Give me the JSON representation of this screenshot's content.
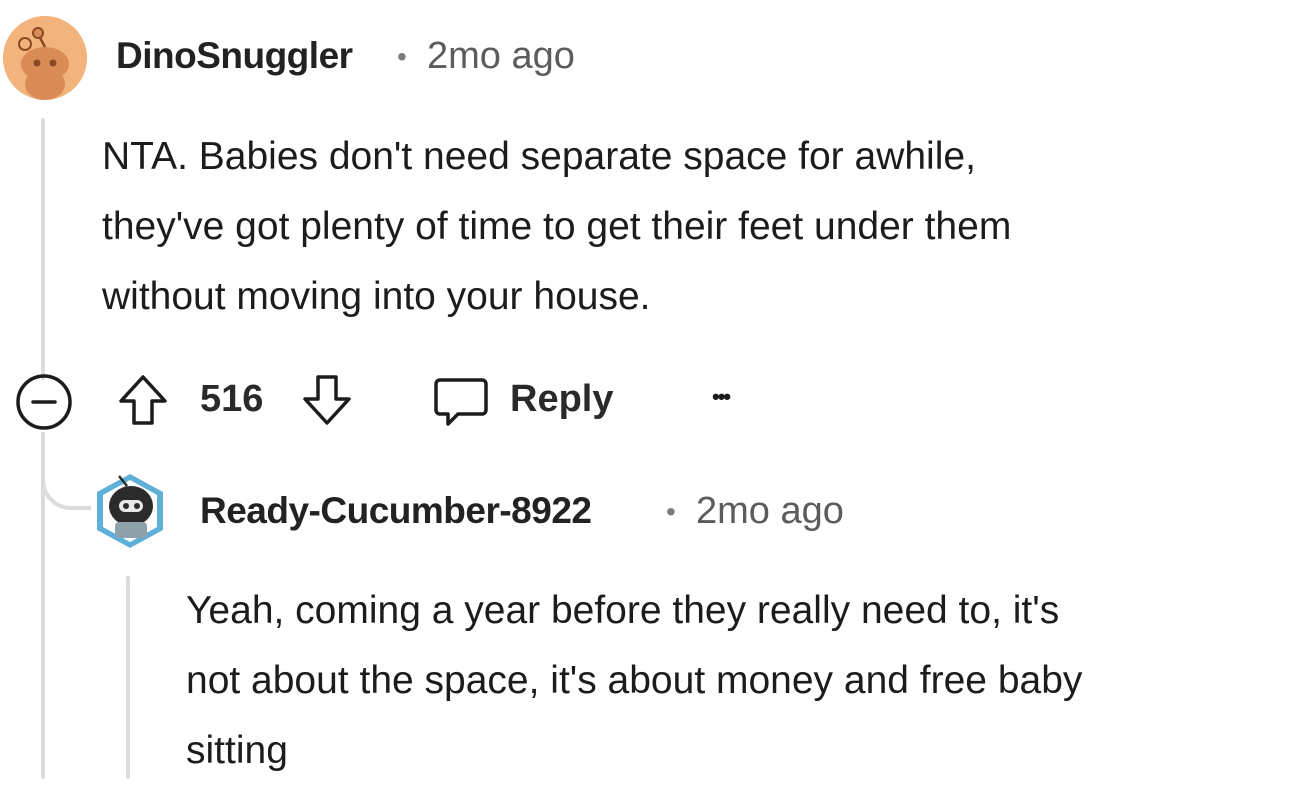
{
  "comments": [
    {
      "username": "DinoSnuggler",
      "separator": "•",
      "time": "2mo ago",
      "lines": [
        "NTA. Babies don't need separate space for awhile,",
        "they've got plenty of time to get their feet under them",
        "without moving into your house."
      ],
      "actions": {
        "score": "516",
        "reply_label": "Reply",
        "more_label": "•••"
      }
    },
    {
      "username": "Ready-Cucumber-8922",
      "separator": "•",
      "time": "2mo ago",
      "lines": [
        "Yeah, coming a year before they really need to, it's",
        "not about the space, it's about money and free baby",
        "sitting"
      ]
    }
  ],
  "colors": {
    "avatar1_bg": "#f2b37c",
    "thread_line": "#dcdcdc",
    "muted_text": "#5c5c5c"
  },
  "icons": {
    "collapse": "minus-circle-icon",
    "upvote": "upvote-arrow-icon",
    "downvote": "downvote-arrow-icon",
    "reply": "speech-bubble-icon",
    "more": "ellipsis-icon"
  }
}
